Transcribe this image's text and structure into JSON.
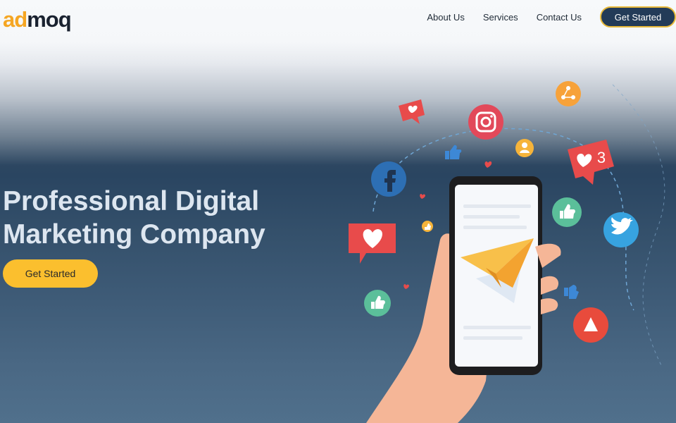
{
  "brand": {
    "logo_part1": "ad",
    "logo_part2": "moq"
  },
  "nav": {
    "items": [
      {
        "label": "About Us"
      },
      {
        "label": "Services"
      },
      {
        "label": "Contact Us"
      }
    ],
    "cta_label": "Get Started"
  },
  "hero": {
    "title_line1": "Professional Digital",
    "title_line2": "Marketing Company",
    "cta_label": "Get Started"
  },
  "illustration": {
    "notification_count": "3",
    "icons": [
      "facebook-icon",
      "instagram-icon",
      "twitter-icon",
      "youtube-play-icon",
      "share-icon",
      "user-icon",
      "like-icon",
      "heart-icon",
      "paper-plane-icon"
    ]
  },
  "colors": {
    "accent_yellow": "#fbbf2e",
    "nav_button": "#233b58",
    "hero_text": "#dde6f0",
    "facebook": "#2d6fb4",
    "instagram": "#e2495a",
    "twitter": "#37a3e0",
    "like_green": "#5bbf9a",
    "youtube_red": "#e84b3c",
    "share_orange": "#f7a23a"
  }
}
